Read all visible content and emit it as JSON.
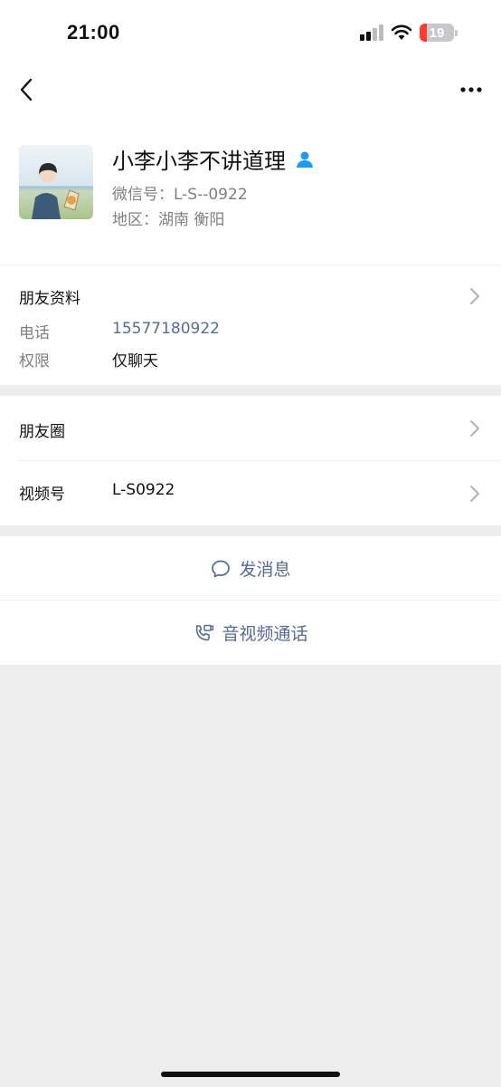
{
  "status_bar": {
    "time": "21:00",
    "battery_level": "19",
    "icons": [
      "cellular-signal-icon",
      "wifi-icon",
      "battery-charging-icon"
    ]
  },
  "nav": {
    "back_icon": "chevron-left-icon",
    "more_icon": "ellipsis-icon"
  },
  "profile": {
    "nickname": "小李小李不讲道理",
    "wechat_id": "微信号：L-S--0922",
    "region": "地区：湖南 衡阳",
    "badge_icon": "contact-person-icon"
  },
  "friend_info": {
    "title": "朋友资料",
    "phone_label": "电话",
    "phone_value": "15577180922",
    "permission_label": "权限",
    "permission_value": "仅聊天"
  },
  "moments": {
    "label": "朋友圈"
  },
  "channels": {
    "label": "视频号",
    "value": "L-S0922"
  },
  "actions": {
    "message_label": "发消息",
    "call_label": "音视频通话"
  },
  "colors": {
    "link": "#576b95",
    "background": "#ededed",
    "battery_low": "#ff3b30",
    "badge": "#1d9bf0"
  }
}
